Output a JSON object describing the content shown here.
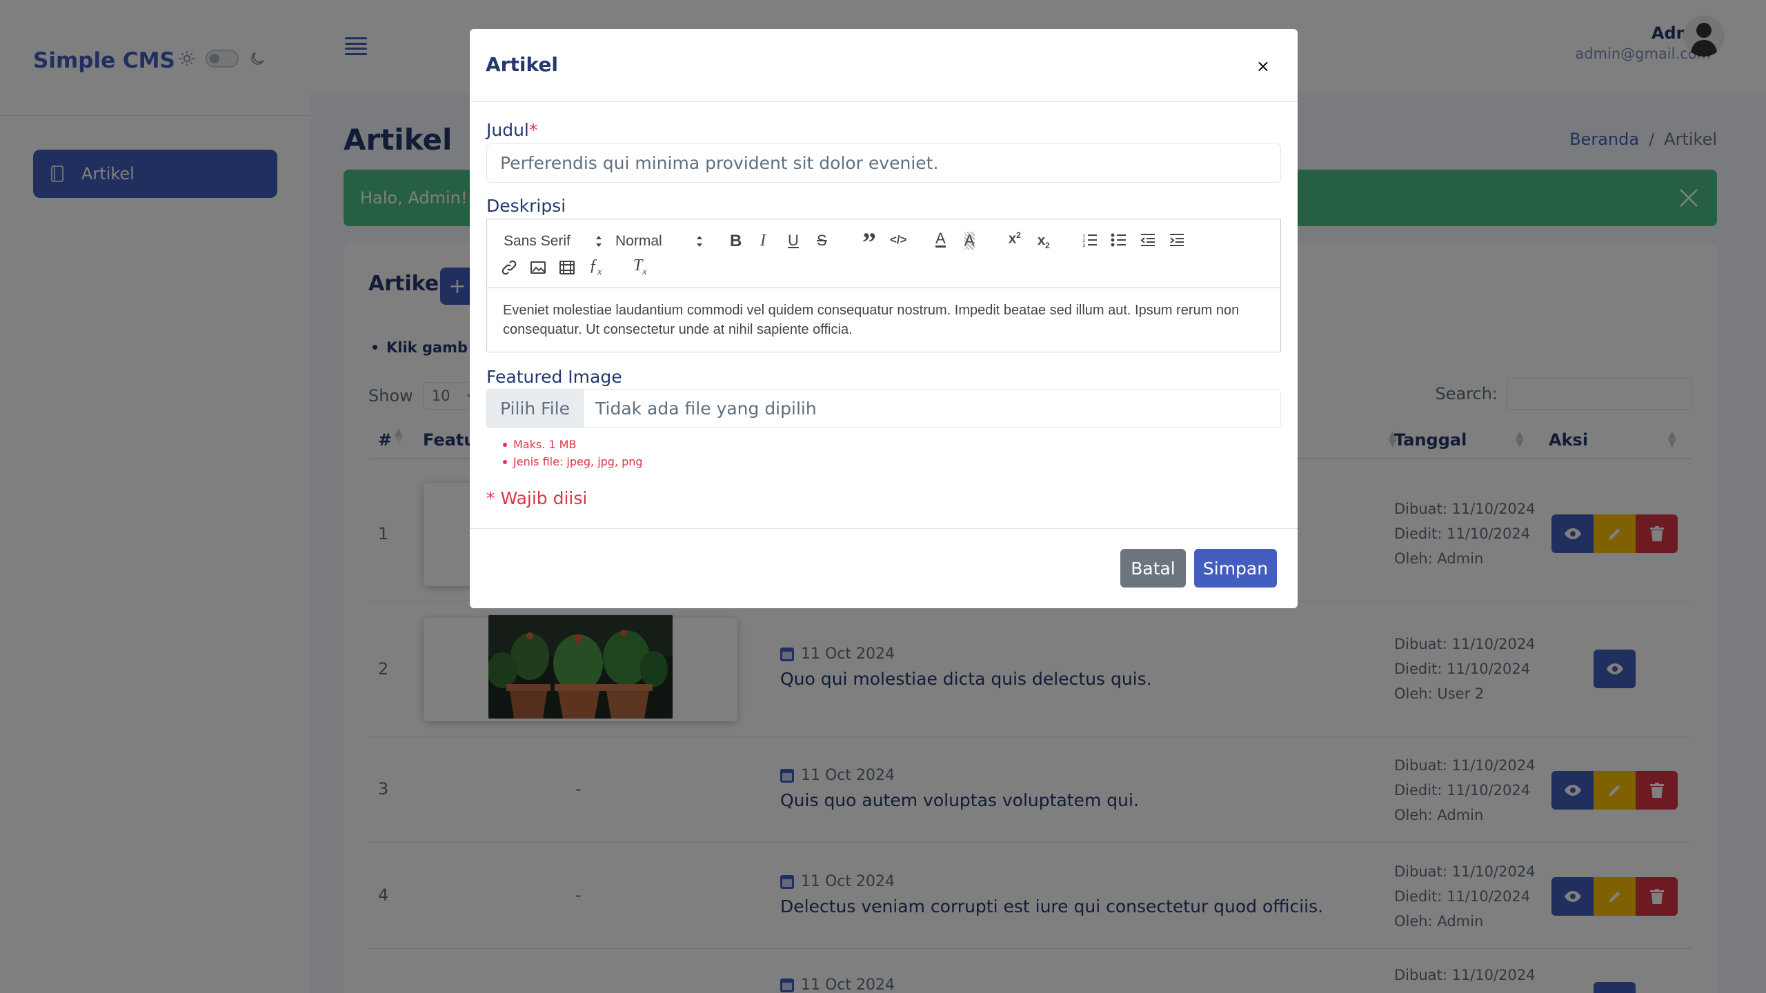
{
  "app": {
    "brand": "Simple CMS"
  },
  "sidebar": {
    "items": [
      {
        "label": "Artikel",
        "icon": "document-icon",
        "active": true
      }
    ]
  },
  "header": {
    "user_name": "Admin",
    "user_email": "admin@gmail.com"
  },
  "page": {
    "title": "Artikel",
    "breadcrumb": {
      "home": "Beranda",
      "separator": "/",
      "current": "Artikel"
    },
    "alert": "Halo, Admin!"
  },
  "card": {
    "title": "Artikel",
    "add_label": "+",
    "hint": "Klik gamb",
    "show_label": "Show",
    "show_value": "10",
    "search_label": "Search:",
    "columns": [
      "#",
      "Featur",
      "Tanggal",
      "Aksi"
    ]
  },
  "rows": [
    {
      "num": "1",
      "date": "",
      "title": "",
      "created": "Dibuat: 11/10/2024",
      "edited": "Diedit: 11/10/2024",
      "by": "Oleh: Admin"
    },
    {
      "num": "2",
      "date": "11 Oct 2024",
      "title": "Quo qui molestiae dicta quis delectus quis.",
      "created": "Dibuat: 11/10/2024",
      "edited": "Diedit: 11/10/2024",
      "by": "Oleh: User 2"
    },
    {
      "num": "3",
      "image": "-",
      "date": "11 Oct 2024",
      "title": "Quis quo autem voluptas voluptatem qui.",
      "created": "Dibuat: 11/10/2024",
      "edited": "Diedit: 11/10/2024",
      "by": "Oleh: Admin"
    },
    {
      "num": "4",
      "image": "-",
      "date": "11 Oct 2024",
      "title": "Delectus veniam corrupti est iure qui consectetur quod officiis.",
      "created": "Dibuat: 11/10/2024",
      "edited": "Diedit: 11/10/2024",
      "by": "Oleh: Admin"
    },
    {
      "num": "",
      "date": "11 Oct 2024",
      "title": "",
      "created": "Dibuat: 11/10/2024",
      "edited": "",
      "by": ""
    }
  ],
  "modal": {
    "title": "Artikel",
    "close": "×",
    "judul_label": "Judul",
    "required_mark": "*",
    "judul_value": "Perferendis qui minima provident sit dolor eveniet.",
    "deskripsi_label": "Deskripsi",
    "toolbar": {
      "font": "Sans Serif",
      "size": "Normal"
    },
    "deskripsi_value": "Eveniet molestiae laudantium commodi vel quidem consequatur nostrum. Impedit beatae sed illum aut. Ipsum rerum non consequatur. Ut consectetur unde at nihil sapiente officia.",
    "image_label": "Featured Image",
    "file_button": "Pilih File",
    "file_status": "Tidak ada file yang dipilih",
    "notes": [
      "Maks. 1 MB",
      "Jenis file: jpeg, jpg, png"
    ],
    "required_note": "* Wajib diisi",
    "cancel": "Batal",
    "save": "Simpan"
  },
  "colors": {
    "primary": "#435ebe",
    "success": "#4fbe87",
    "warning": "#ffc107",
    "danger": "#dc3545",
    "secondary": "#6c757d"
  }
}
